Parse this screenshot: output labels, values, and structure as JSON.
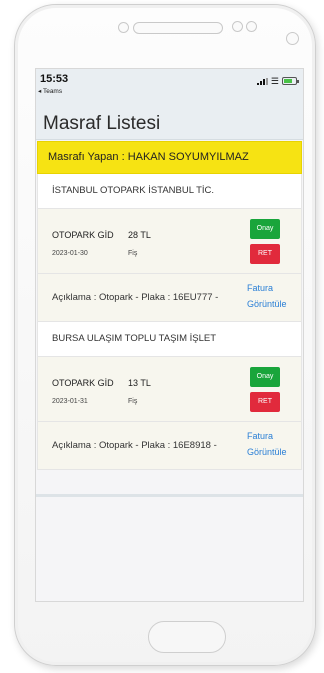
{
  "status": {
    "time": "15:53",
    "back_label": "◂ Teams"
  },
  "page": {
    "title": "Masraf Listesi"
  },
  "banner": {
    "text": "Masrafı Yapan : HAKAN SOYUMYILMAZ"
  },
  "expenses": [
    {
      "company": "İSTANBUL OTOPARK İSTANBUL TİC.",
      "type": "OTOPARK GİD",
      "amount": "28 TL",
      "date": "2023-01-30",
      "doc_type": "Fiş",
      "approve_label": "Onay",
      "reject_label": "RET",
      "description": "Açıklama : Otopark - Plaka : 16EU777 -",
      "invoice_link": "Fatura Görüntüle"
    },
    {
      "company": "BURSA ULAŞIM TOPLU TAŞIM İŞLET",
      "type": "OTOPARK GİD",
      "amount": "13 TL",
      "date": "2023-01-31",
      "doc_type": "Fiş",
      "approve_label": "Onay",
      "reject_label": "RET",
      "description": "Açıklama : Otopark - Plaka : 16E8918 -",
      "invoice_link": "Fatura Görüntüle"
    }
  ],
  "colors": {
    "banner": "#f6e313",
    "approve": "#19a53b",
    "reject": "#e12a3c",
    "link": "#2a7fd6"
  },
  "icons": [
    "signal-icon",
    "wifi-icon",
    "battery-icon"
  ]
}
